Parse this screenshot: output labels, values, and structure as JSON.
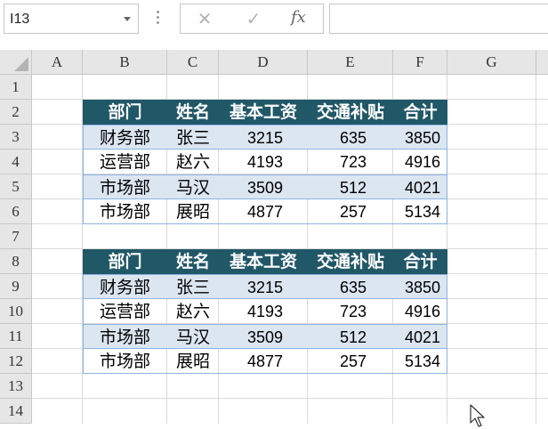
{
  "formula_bar": {
    "name_box": "I13",
    "cancel_icon": "✕",
    "enter_icon": "✓",
    "fx_label": "fx",
    "formula": ""
  },
  "columns": [
    "A",
    "B",
    "C",
    "D",
    "E",
    "F",
    "G"
  ],
  "rows": [
    "1",
    "2",
    "3",
    "4",
    "5",
    "6",
    "7",
    "8",
    "9",
    "10",
    "11",
    "12",
    "13",
    "14"
  ],
  "tables": [
    {
      "headers": [
        "部门",
        "姓名",
        "基本工资",
        "交通补贴",
        "合计"
      ],
      "rows": [
        [
          "财务部",
          "张三",
          "3215",
          "635",
          "3850"
        ],
        [
          "运营部",
          "赵六",
          "4193",
          "723",
          "4916"
        ],
        [
          "市场部",
          "马汉",
          "3509",
          "512",
          "4021"
        ],
        [
          "市场部",
          "展昭",
          "4877",
          "257",
          "5134"
        ]
      ]
    },
    {
      "headers": [
        "部门",
        "姓名",
        "基本工资",
        "交通补贴",
        "合计"
      ],
      "rows": [
        [
          "财务部",
          "张三",
          "3215",
          "635",
          "3850"
        ],
        [
          "运营部",
          "赵六",
          "4193",
          "723",
          "4916"
        ],
        [
          "市场部",
          "马汉",
          "3509",
          "512",
          "4021"
        ],
        [
          "市场部",
          "展昭",
          "4877",
          "257",
          "5134"
        ]
      ]
    }
  ],
  "colors": {
    "header_fill": "#215868",
    "band_fill": "#dce6f1",
    "border": "#8db4e2"
  }
}
